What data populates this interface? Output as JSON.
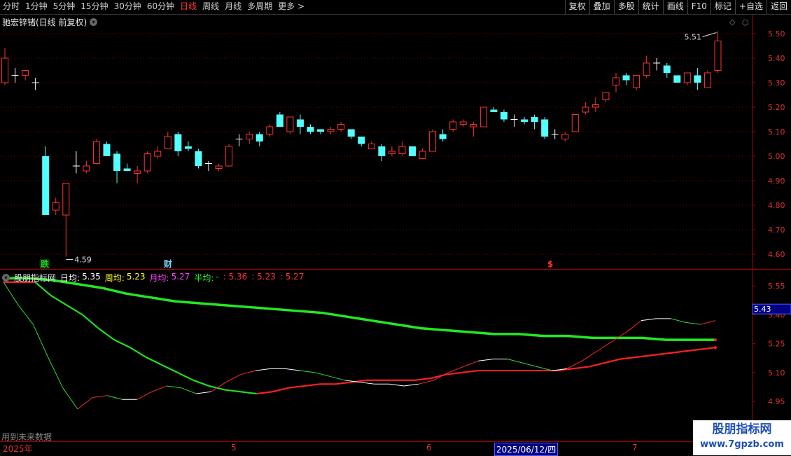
{
  "toolbar": {
    "periods": [
      "分时",
      "1分钟",
      "5分钟",
      "15分钟",
      "30分钟",
      "60分钟",
      "日线",
      "周线",
      "月线",
      "多周期",
      "更多 >"
    ],
    "active_period": "日线",
    "tools": [
      "复权",
      "叠加",
      "多股",
      "统计",
      "画线",
      "F10",
      "标记",
      "+自选",
      "返回"
    ]
  },
  "main": {
    "title": "驰宏锌锗(日线 前复权)",
    "price_axis": [
      "5.50",
      "5.40",
      "5.30",
      "5.20",
      "5.10",
      "5.00",
      "4.90",
      "4.80",
      "4.70",
      "4.60"
    ],
    "high_marker": "5.51",
    "low_marker": "4.59",
    "events": [
      {
        "label": "跌",
        "color": "#19d419"
      },
      {
        "label": "财",
        "color": "#7fd4ff"
      },
      {
        "label": "$",
        "color": "#ff3030"
      }
    ]
  },
  "indicator": {
    "name": "股朋指标网",
    "items": [
      {
        "label": "日均:",
        "value": "5.35",
        "color": "#ffffff"
      },
      {
        "label": "周均:",
        "value": "5.23",
        "color": "#ffff33"
      },
      {
        "label": "月均:",
        "value": "5.27",
        "color": "#ff44ff"
      },
      {
        "label": "半均:",
        "value": "-",
        "color": "#33ff33"
      }
    ],
    "extra_values": [
      ": 5.36",
      ": 5.23",
      ": 5.27"
    ],
    "extra_color": "#ff3333",
    "axis": [
      "5.55",
      "5.40",
      "5.25",
      "5.10",
      "4.95"
    ],
    "current_value": "5.43",
    "footer_note": "用到未来数据"
  },
  "xaxis": {
    "labels": [
      {
        "text": "2025年"
      },
      {
        "text": "5"
      },
      {
        "text": "6"
      },
      {
        "text": "7"
      }
    ],
    "date_tag": "2025/06/12/四"
  },
  "watermark": {
    "title": "股朋指标网",
    "url": "www.7gpzb.com"
  },
  "chart_data": [
    {
      "type": "candlestick",
      "title": "驰宏锌锗(日线 前复权)",
      "ylim": [
        4.56,
        5.56
      ],
      "candles": [
        {
          "o": 5.3,
          "h": 5.44,
          "l": 5.29,
          "c": 5.4
        },
        {
          "o": 5.33,
          "h": 5.36,
          "l": 5.3,
          "c": 5.33
        },
        {
          "o": 5.33,
          "h": 5.35,
          "l": 5.31,
          "c": 5.35
        },
        {
          "o": 5.3,
          "h": 5.32,
          "l": 5.27,
          "c": 5.3
        },
        {
          "o": 5.0,
          "h": 5.04,
          "l": 4.76,
          "c": 4.76
        },
        {
          "o": 4.78,
          "h": 4.83,
          "l": 4.76,
          "c": 4.81
        },
        {
          "o": 4.76,
          "h": 4.89,
          "l": 4.59,
          "c": 4.89
        },
        {
          "o": 4.96,
          "h": 5.02,
          "l": 4.93,
          "c": 4.96
        },
        {
          "o": 4.94,
          "h": 4.98,
          "l": 4.93,
          "c": 4.96
        },
        {
          "o": 4.97,
          "h": 5.07,
          "l": 4.97,
          "c": 5.06
        },
        {
          "o": 5.05,
          "h": 5.06,
          "l": 5.0,
          "c": 5.0
        },
        {
          "o": 5.01,
          "h": 5.02,
          "l": 4.89,
          "c": 4.94
        },
        {
          "o": 4.95,
          "h": 4.97,
          "l": 4.94,
          "c": 4.94
        },
        {
          "o": 4.93,
          "h": 4.96,
          "l": 4.89,
          "c": 4.94
        },
        {
          "o": 4.94,
          "h": 5.02,
          "l": 4.93,
          "c": 5.01
        },
        {
          "o": 5.0,
          "h": 5.04,
          "l": 4.99,
          "c": 5.02
        },
        {
          "o": 5.03,
          "h": 5.1,
          "l": 5.03,
          "c": 5.08
        },
        {
          "o": 5.09,
          "h": 5.1,
          "l": 5.0,
          "c": 5.02
        },
        {
          "o": 5.04,
          "h": 5.06,
          "l": 5.02,
          "c": 5.03
        },
        {
          "o": 5.02,
          "h": 5.03,
          "l": 4.95,
          "c": 4.96
        },
        {
          "o": 4.97,
          "h": 4.98,
          "l": 4.94,
          "c": 4.97
        },
        {
          "o": 4.95,
          "h": 4.97,
          "l": 4.94,
          "c": 4.96
        },
        {
          "o": 4.96,
          "h": 5.05,
          "l": 4.96,
          "c": 5.04
        },
        {
          "o": 5.07,
          "h": 5.09,
          "l": 5.04,
          "c": 5.07
        },
        {
          "o": 5.07,
          "h": 5.1,
          "l": 5.05,
          "c": 5.09
        },
        {
          "o": 5.09,
          "h": 5.1,
          "l": 5.04,
          "c": 5.06
        },
        {
          "o": 5.09,
          "h": 5.13,
          "l": 5.08,
          "c": 5.12
        },
        {
          "o": 5.17,
          "h": 5.18,
          "l": 5.12,
          "c": 5.12
        },
        {
          "o": 5.1,
          "h": 5.16,
          "l": 5.09,
          "c": 5.16
        },
        {
          "o": 5.15,
          "h": 5.17,
          "l": 5.09,
          "c": 5.12
        },
        {
          "o": 5.12,
          "h": 5.13,
          "l": 5.09,
          "c": 5.1
        },
        {
          "o": 5.11,
          "h": 5.11,
          "l": 5.09,
          "c": 5.1
        },
        {
          "o": 5.1,
          "h": 5.12,
          "l": 5.09,
          "c": 5.11
        },
        {
          "o": 5.11,
          "h": 5.14,
          "l": 5.1,
          "c": 5.13
        },
        {
          "o": 5.11,
          "h": 5.11,
          "l": 5.07,
          "c": 5.08
        },
        {
          "o": 5.08,
          "h": 5.08,
          "l": 5.04,
          "c": 5.05
        },
        {
          "o": 5.03,
          "h": 5.06,
          "l": 5.03,
          "c": 5.05
        },
        {
          "o": 5.04,
          "h": 5.05,
          "l": 4.98,
          "c": 5.0
        },
        {
          "o": 5.01,
          "h": 5.04,
          "l": 5.0,
          "c": 5.02
        },
        {
          "o": 5.01,
          "h": 5.06,
          "l": 5.0,
          "c": 5.04
        },
        {
          "o": 5.04,
          "h": 5.04,
          "l": 5.0,
          "c": 5.0
        },
        {
          "o": 4.99,
          "h": 5.03,
          "l": 4.99,
          "c": 5.02
        },
        {
          "o": 5.02,
          "h": 5.11,
          "l": 5.02,
          "c": 5.1
        },
        {
          "o": 5.09,
          "h": 5.11,
          "l": 5.06,
          "c": 5.07
        },
        {
          "o": 5.11,
          "h": 5.15,
          "l": 5.1,
          "c": 5.14
        },
        {
          "o": 5.13,
          "h": 5.15,
          "l": 5.12,
          "c": 5.14
        },
        {
          "o": 5.12,
          "h": 5.14,
          "l": 5.08,
          "c": 5.13
        },
        {
          "o": 5.12,
          "h": 5.2,
          "l": 5.12,
          "c": 5.2
        },
        {
          "o": 5.19,
          "h": 5.2,
          "l": 5.18,
          "c": 5.18
        },
        {
          "o": 5.18,
          "h": 5.19,
          "l": 5.14,
          "c": 5.15
        },
        {
          "o": 5.15,
          "h": 5.17,
          "l": 5.12,
          "c": 5.15
        },
        {
          "o": 5.15,
          "h": 5.16,
          "l": 5.13,
          "c": 5.14
        },
        {
          "o": 5.16,
          "h": 5.17,
          "l": 5.11,
          "c": 5.14
        },
        {
          "o": 5.15,
          "h": 5.16,
          "l": 5.07,
          "c": 5.08
        },
        {
          "o": 5.09,
          "h": 5.11,
          "l": 5.07,
          "c": 5.09
        },
        {
          "o": 5.07,
          "h": 5.1,
          "l": 5.06,
          "c": 5.09
        },
        {
          "o": 5.1,
          "h": 5.17,
          "l": 5.1,
          "c": 5.17
        },
        {
          "o": 5.18,
          "h": 5.22,
          "l": 5.17,
          "c": 5.2
        },
        {
          "o": 5.2,
          "h": 5.24,
          "l": 5.18,
          "c": 5.21
        },
        {
          "o": 5.23,
          "h": 5.26,
          "l": 5.22,
          "c": 5.26
        },
        {
          "o": 5.29,
          "h": 5.34,
          "l": 5.26,
          "c": 5.32
        },
        {
          "o": 5.33,
          "h": 5.34,
          "l": 5.29,
          "c": 5.31
        },
        {
          "o": 5.28,
          "h": 5.33,
          "l": 5.27,
          "c": 5.33
        },
        {
          "o": 5.33,
          "h": 5.41,
          "l": 5.32,
          "c": 5.38
        },
        {
          "o": 5.38,
          "h": 5.4,
          "l": 5.35,
          "c": 5.38
        },
        {
          "o": 5.37,
          "h": 5.38,
          "l": 5.32,
          "c": 5.34
        },
        {
          "o": 5.33,
          "h": 5.33,
          "l": 5.3,
          "c": 5.3
        },
        {
          "o": 5.3,
          "h": 5.34,
          "l": 5.29,
          "c": 5.34
        },
        {
          "o": 5.33,
          "h": 5.36,
          "l": 5.27,
          "c": 5.3
        },
        {
          "o": 5.28,
          "h": 5.35,
          "l": 5.28,
          "c": 5.34
        },
        {
          "o": 5.35,
          "h": 5.51,
          "l": 5.34,
          "c": 5.47
        }
      ]
    },
    {
      "type": "line",
      "title": "股朋指标网",
      "ylim": [
        4.87,
        5.62
      ],
      "series": [
        {
          "name": "日均",
          "color_segments": true,
          "values": [
            5.57,
            5.45,
            5.35,
            5.18,
            5.02,
            4.91,
            4.97,
            4.98,
            4.96,
            4.96,
            5.0,
            5.03,
            5.02,
            4.99,
            5.0,
            5.05,
            5.09,
            5.11,
            5.12,
            5.12,
            5.11,
            5.1,
            5.08,
            5.06,
            5.05,
            5.04,
            5.04,
            5.03,
            5.04,
            5.06,
            5.1,
            5.13,
            5.16,
            5.17,
            5.17,
            5.15,
            5.13,
            5.11,
            5.12,
            5.16,
            5.21,
            5.26,
            5.31,
            5.37,
            5.38,
            5.38,
            5.36,
            5.35,
            5.37
          ]
        },
        {
          "name": "周均",
          "values": [
            5.57,
            5.57,
            5.57,
            5.5,
            5.45,
            5.4,
            5.33,
            5.27,
            5.23,
            5.18,
            5.14,
            5.1,
            5.06,
            5.03,
            5.01,
            5.0,
            4.99,
            5.0,
            5.02,
            5.03,
            5.04,
            5.04,
            5.05,
            5.06,
            5.06,
            5.06,
            5.06,
            5.07,
            5.09,
            5.1,
            5.11,
            5.11,
            5.11,
            5.11,
            5.11,
            5.11,
            5.12,
            5.13,
            5.15,
            5.17,
            5.18,
            5.19,
            5.2,
            5.21,
            5.22,
            5.23
          ]
        },
        {
          "name": "月均",
          "values": [
            5.59,
            5.59,
            5.58,
            5.56,
            5.54,
            5.51,
            5.49,
            5.47,
            5.46,
            5.45,
            5.44,
            5.43,
            5.42,
            5.41,
            5.39,
            5.37,
            5.35,
            5.33,
            5.32,
            5.31,
            5.3,
            5.3,
            5.29,
            5.29,
            5.28,
            5.28,
            5.28,
            5.27,
            5.27,
            5.27
          ]
        }
      ]
    }
  ]
}
